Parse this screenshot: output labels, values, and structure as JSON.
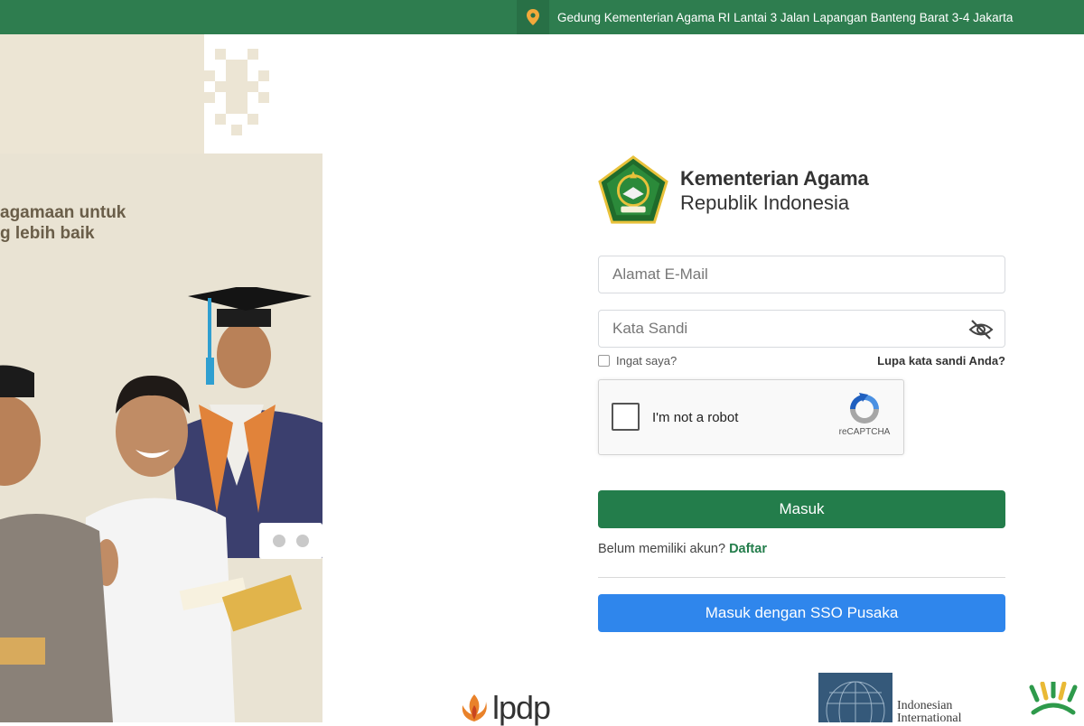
{
  "topbar": {
    "address": "Gedung Kementerian Agama RI Lantai 3 Jalan Lapangan Banteng Barat 3-4 Jakarta",
    "pin_icon": "map-pin-icon"
  },
  "hero": {
    "tagline_line1": "agamaan untuk",
    "tagline_line2": "g lebih baik"
  },
  "brand": {
    "line1": "Kementerian Agama",
    "line2": "Republik Indonesia",
    "emblem_icon": "kemenag-emblem"
  },
  "form": {
    "email_placeholder": "Alamat E-Mail",
    "password_placeholder": "Kata Sandi",
    "eye_icon": "eye-slash-icon",
    "remember_label": "Ingat saya?",
    "forgot_label": "Lupa kata sandi Anda?",
    "captcha_label": "I'm not a robot",
    "captcha_brand": "reCAPTCHA",
    "login_button": "Masuk",
    "register_prompt": "Belum memiliki akun?",
    "register_link": "Daftar",
    "sso_button": "Masuk dengan SSO Pusaka"
  },
  "partners": {
    "lpdp": "lpdp",
    "uiii_line1": "Indonesian",
    "uiii_line2": "International"
  },
  "colors": {
    "topbar": "#2e7d4f",
    "primary": "#237d4b",
    "sso": "#2f86ec",
    "hero_bg": "#e9e3d3"
  }
}
